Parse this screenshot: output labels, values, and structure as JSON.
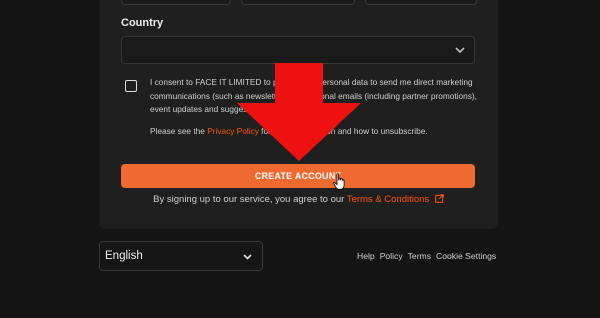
{
  "form": {
    "country_label": "Country",
    "country_value": "",
    "consent_text": "I consent to FACE IT LIMITED to process my personal data to send me direct marketing communications (such as newsletters, promotional emails (including partner promotions), event updates and suggestions).",
    "privacy_prefix": "Please see the ",
    "privacy_link": "Privacy Policy",
    "privacy_suffix": " for more information and how to unsubscribe.",
    "create_account": "CREATE ACCOUNT",
    "signup_prefix": "By signing up to our service, you agree to our ",
    "terms_link": "Terms & Conditions",
    "icons": {
      "country_chevron": "chevron-down-icon",
      "terms_external": "external-link-icon",
      "annotation_arrow": "red-down-arrow-icon",
      "pointer": "hand-cursor-icon"
    }
  },
  "footer": {
    "language": "English",
    "links": [
      "Help",
      "Policy",
      "Terms",
      "Cookie Settings"
    ]
  },
  "colors": {
    "accent": "#ee6a30",
    "link": "#ff5500",
    "annotation_arrow": "#ee1111",
    "background": "#141414",
    "card": "#1f1f1f"
  }
}
